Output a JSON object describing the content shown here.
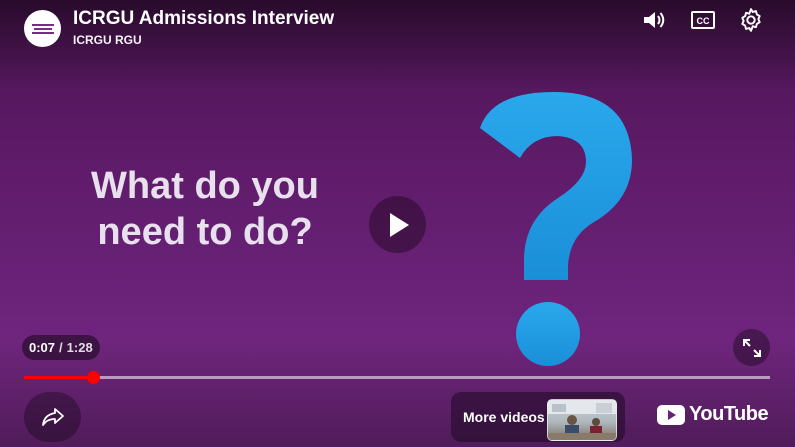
{
  "video": {
    "title": "ICRGU Admissions Interview",
    "channel": "ICRGU RGU",
    "headline_line1": "What do you",
    "headline_line2": "need to do?"
  },
  "player": {
    "current_time": "0:07",
    "separator": "/",
    "duration": "1:28",
    "progress_fraction": 0.093,
    "more_videos_label": "More videos",
    "youtube_label": "YouTube"
  },
  "colors": {
    "background": "#5c1a66",
    "question_mark": "#1fa0e6",
    "progress": "#ff0000"
  },
  "icons": [
    "volume-icon",
    "cc-icon",
    "gear-icon",
    "play-icon",
    "fullscreen-icon",
    "share-icon",
    "youtube-logo-icon"
  ]
}
